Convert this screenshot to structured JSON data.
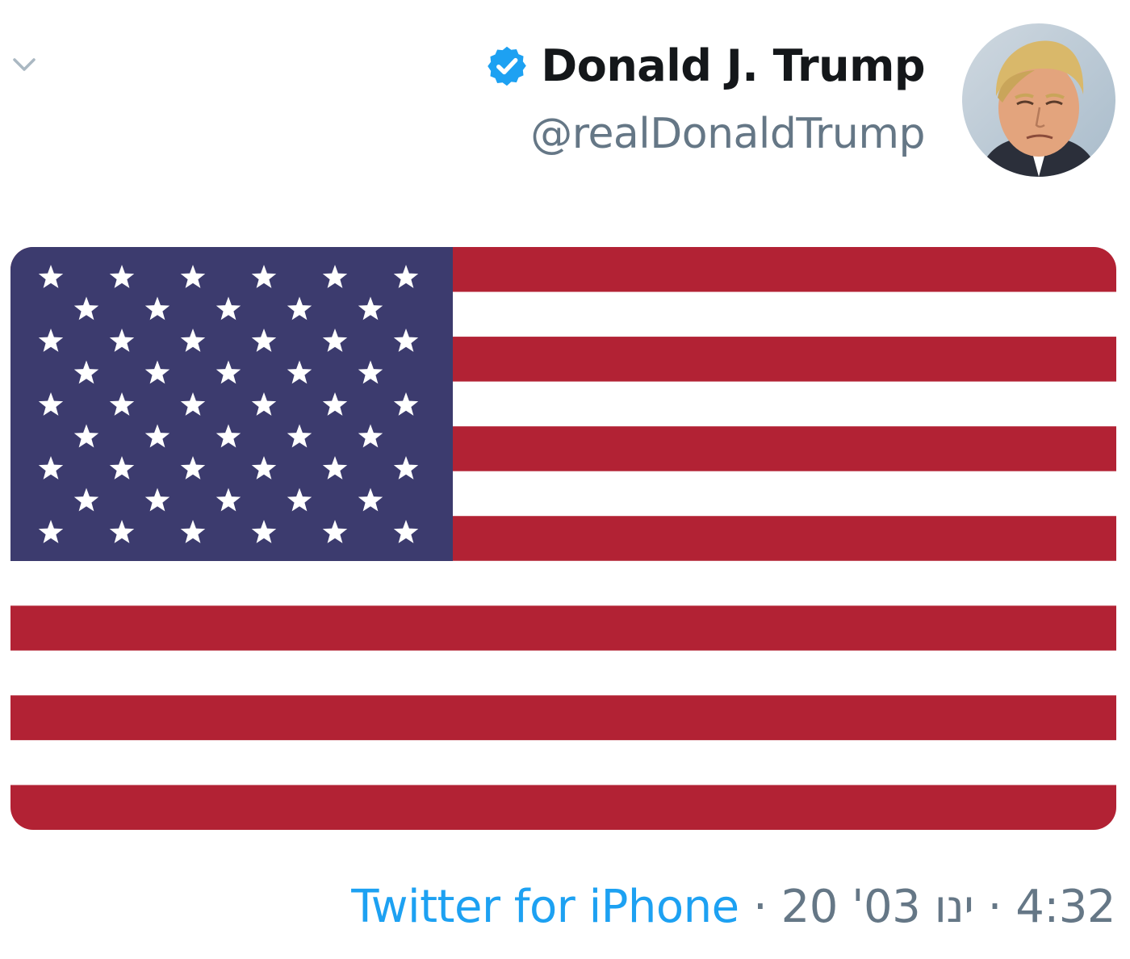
{
  "colors": {
    "name": "#14171a",
    "handle": "#657786",
    "link": "#1da1f2",
    "verified": "#1da1f2",
    "flag_red": "#b22234",
    "flag_blue": "#3c3b6e",
    "flag_white": "#ffffff"
  },
  "icons": {
    "menu": "chevron-down-icon",
    "verified": "verified-badge-icon"
  },
  "tweet": {
    "author": {
      "display_name": "Donald J. Trump",
      "handle": "@realDonaldTrump",
      "verified": true
    },
    "media": {
      "type": "image",
      "subject": "American flag"
    },
    "source": "Twitter for iPhone",
    "separator": "·",
    "date": "20 'ינו 03",
    "time": "4:32"
  }
}
